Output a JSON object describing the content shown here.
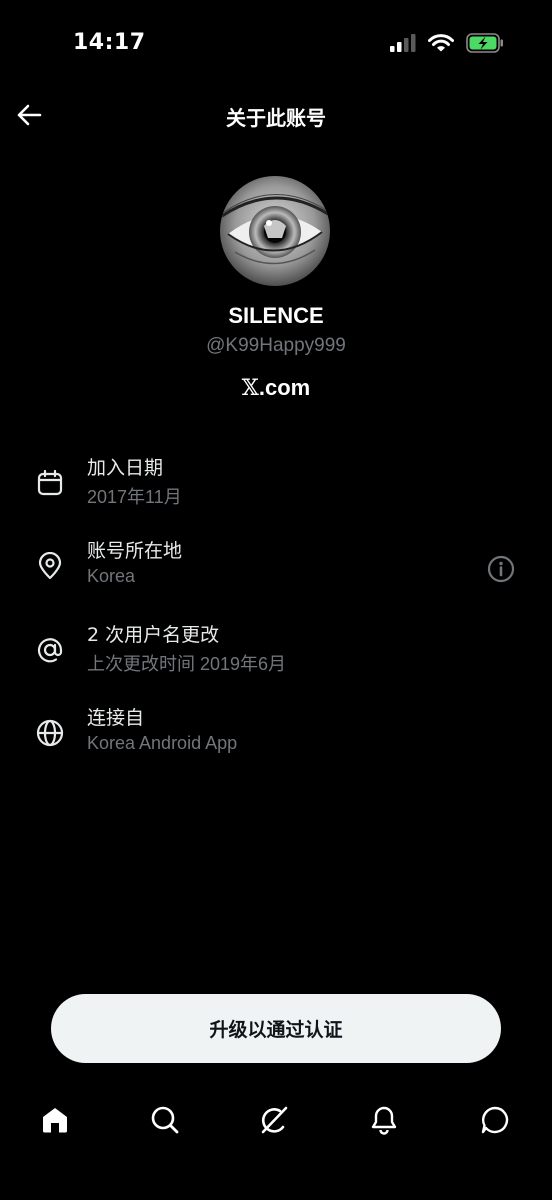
{
  "status_bar": {
    "time": "14:17",
    "icons": [
      "signal-icon",
      "wifi-icon",
      "battery-charging-icon"
    ],
    "battery_color": "#4cd964"
  },
  "header": {
    "title": "关于此账号",
    "back_icon": "back-arrow-icon"
  },
  "profile": {
    "display_name": "SILENCE",
    "handle": "@K99Happy999",
    "site_logo": "𝕏",
    "site_suffix": ".com"
  },
  "info_rows": [
    {
      "icon": "calendar-icon",
      "title": "加入日期",
      "value": "2017年11月"
    },
    {
      "icon": "location-pin-icon",
      "title": "账号所在地",
      "value": "Korea",
      "action_icon": "info-icon"
    },
    {
      "icon": "at-sign-icon",
      "title": "2 次用户名更改",
      "value": "上次更改时间 2019年6月"
    },
    {
      "icon": "globe-icon",
      "title": "连接自",
      "value": "Korea Android App"
    }
  ],
  "cta": {
    "label": "升级以通过认证"
  },
  "tabs": [
    "home-icon",
    "search-icon",
    "grok-icon",
    "notifications-icon",
    "messages-icon"
  ],
  "colors": {
    "background": "#000000",
    "text": "#e7e9ea",
    "secondary_text": "#71767b",
    "button_bg": "#eff3f4"
  }
}
